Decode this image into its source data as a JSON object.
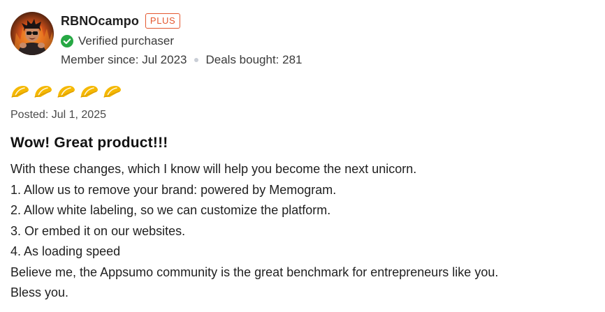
{
  "reviewer": {
    "name": "RBNOcampo",
    "badge": "PLUS",
    "verified_label": "Verified purchaser",
    "member_since": "Member since: Jul 2023",
    "deals_bought": "Deals bought: 281",
    "avatar_icon": "avatar-portrait"
  },
  "rating": {
    "value": 5,
    "max": 5,
    "icon": "taco-icon",
    "color": "#f5b800"
  },
  "posted": "Posted: Jul 1, 2025",
  "review": {
    "title": "Wow! Great product!!!",
    "lines": [
      "With these changes, which I know will help you become the next unicorn.",
      "1. Allow us to remove your brand: powered by Memogram.",
      "2. Allow white labeling, so we can customize the platform.",
      "3. Or embed it on our websites.",
      "4. As loading speed",
      "Believe me, the Appsumo community is the great benchmark for entrepreneurs like you.",
      "Bless you."
    ]
  },
  "colors": {
    "plus_badge": "#e4572e",
    "verified_check": "#27a844",
    "dot_separator": "#c9ced6"
  }
}
